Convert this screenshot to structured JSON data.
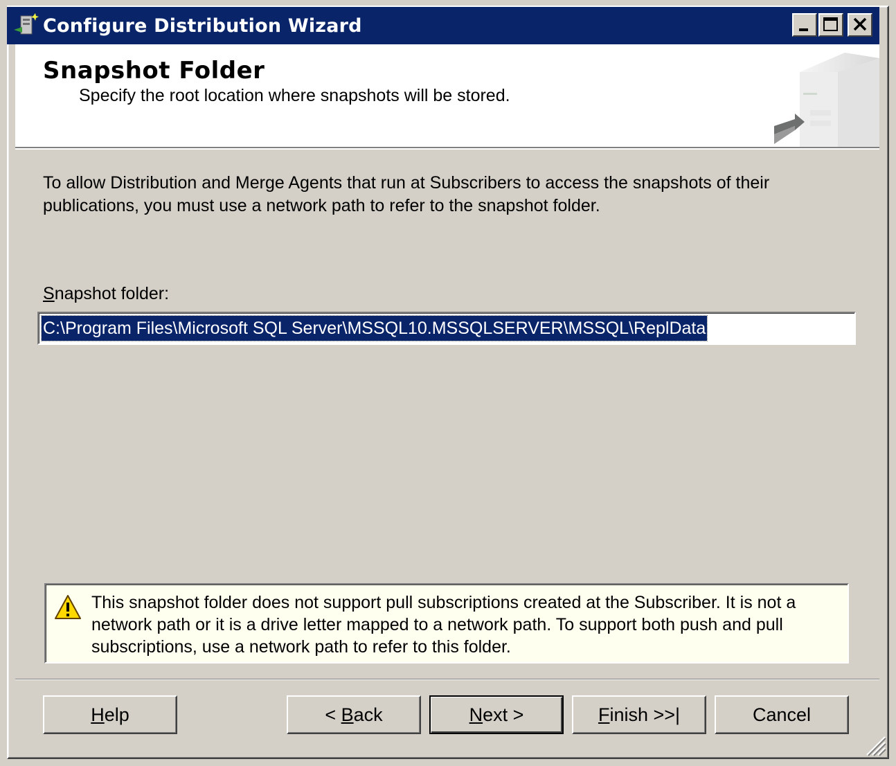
{
  "window": {
    "title": "Configure Distribution Wizard",
    "title_buttons": [
      "minimize",
      "maximize",
      "close"
    ]
  },
  "header": {
    "title": "Snapshot Folder",
    "subtitle": "Specify the root location where snapshots will be stored."
  },
  "body": {
    "intro": "To allow Distribution and Merge Agents that run at Subscribers to access the snapshots of their publications, you must use a network path to refer to the snapshot folder.",
    "folder_label_hotkey": "S",
    "folder_label_rest": "napshot folder:",
    "folder_value": "C:\\Program Files\\Microsoft SQL Server\\MSSQL10.MSSQLSERVER\\MSSQL\\ReplData"
  },
  "warning": {
    "icon": "warning-icon",
    "text": "This snapshot folder does not support pull subscriptions created at the Subscriber. It is not a network path or it is a drive letter mapped to a network path. To support both push and pull subscriptions, use a network path to refer to this folder."
  },
  "buttons": {
    "help": {
      "pre": "",
      "hot": "H",
      "post": "elp"
    },
    "back": {
      "pre": "< ",
      "hot": "B",
      "post": "ack"
    },
    "next": {
      "pre": "",
      "hot": "N",
      "post": "ext >"
    },
    "finish": {
      "pre": "",
      "hot": "F",
      "post": "inish >>|"
    },
    "cancel": {
      "pre": "Cancel",
      "hot": "",
      "post": ""
    }
  },
  "colors": {
    "titlebar": "#0a246a",
    "face": "#d4d0c8",
    "selection": "#0a246a",
    "warning_bg": "#fffff0"
  }
}
